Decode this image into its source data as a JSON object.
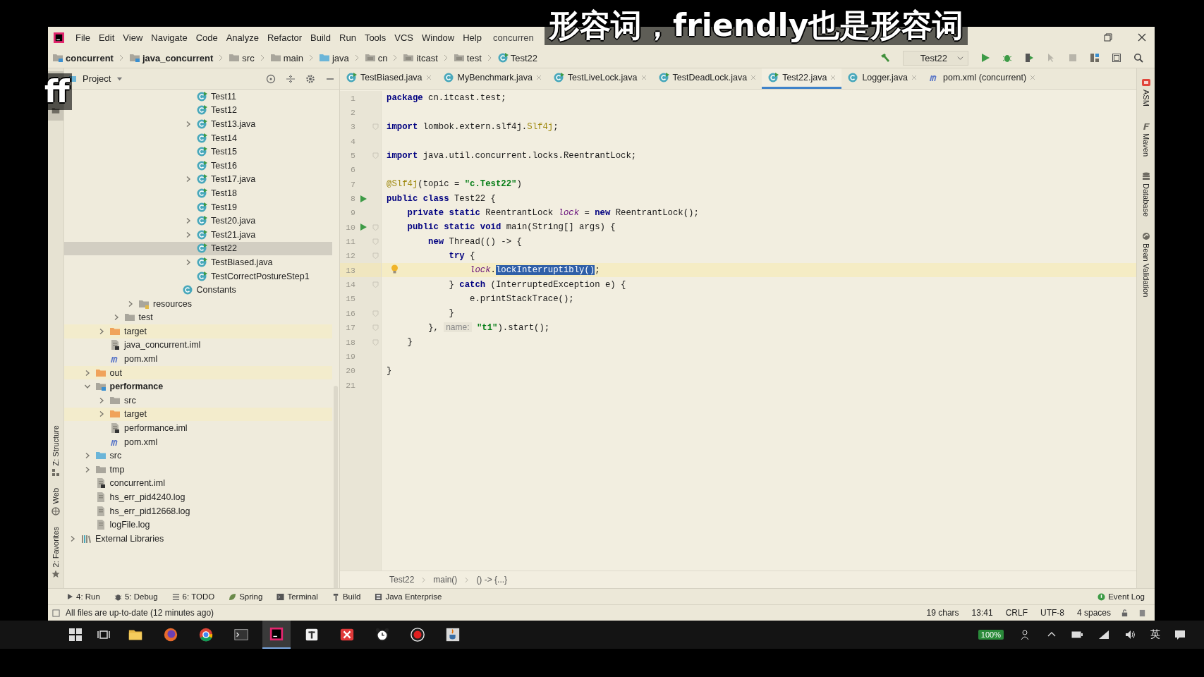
{
  "overlay": {
    "subtitle": "形容词，friendly也是形容词",
    "fragment": "ff"
  },
  "window": {
    "title": "concurren"
  },
  "menu": [
    "File",
    "Edit",
    "View",
    "Navigate",
    "Code",
    "Analyze",
    "Refactor",
    "Build",
    "Run",
    "Tools",
    "VCS",
    "Window",
    "Help"
  ],
  "navbar": {
    "crumbs": [
      {
        "label": "concurrent",
        "kind": "module"
      },
      {
        "label": "java_concurrent",
        "kind": "module"
      },
      {
        "label": "src",
        "kind": "folder"
      },
      {
        "label": "main",
        "kind": "folder"
      },
      {
        "label": "java",
        "kind": "source"
      },
      {
        "label": "cn",
        "kind": "package"
      },
      {
        "label": "itcast",
        "kind": "package"
      },
      {
        "label": "test",
        "kind": "package"
      },
      {
        "label": "Test22",
        "kind": "runnable"
      }
    ],
    "run_config": "Test22"
  },
  "project": {
    "title": "Project",
    "tree": [
      {
        "children": [
          {
            "children": [
              {
                "children": [
                  {
                    "children": [
                      {
                        "children": [
                          {
                            "children": [
                              {
                                "children": [
                                  {
                                    "children": [
                                      {
                                        "label": "Test11",
                                        "kind": "runnable",
                                        "selected": false,
                                        "excluded": false
                                      },
                                      {
                                        "label": "Test12",
                                        "kind": "runnable",
                                        "selected": false,
                                        "excluded": false
                                      },
                                      {
                                        "label": "Test13.java",
                                        "kind": "runnable",
                                        "expanded": false,
                                        "selected": false,
                                        "excluded": false
                                      },
                                      {
                                        "label": "Test14",
                                        "kind": "runnable",
                                        "selected": false,
                                        "excluded": false
                                      },
                                      {
                                        "label": "Test15",
                                        "kind": "runnable",
                                        "selected": false,
                                        "excluded": false
                                      },
                                      {
                                        "label": "Test16",
                                        "kind": "runnable",
                                        "selected": false,
                                        "excluded": false
                                      },
                                      {
                                        "label": "Test17.java",
                                        "kind": "runnable",
                                        "expanded": false,
                                        "selected": false,
                                        "excluded": false
                                      },
                                      {
                                        "label": "Test18",
                                        "kind": "runnable",
                                        "selected": false,
                                        "excluded": false
                                      },
                                      {
                                        "label": "Test19",
                                        "kind": "runnable",
                                        "selected": false,
                                        "excluded": false
                                      },
                                      {
                                        "label": "Test20.java",
                                        "kind": "runnable",
                                        "expanded": false,
                                        "selected": false,
                                        "excluded": false
                                      },
                                      {
                                        "label": "Test21.java",
                                        "kind": "runnable",
                                        "expanded": false,
                                        "selected": false,
                                        "excluded": false
                                      },
                                      {
                                        "label": "Test22",
                                        "kind": "runnable",
                                        "selected": true,
                                        "excluded": false
                                      },
                                      {
                                        "label": "TestBiased.java",
                                        "kind": "runnable",
                                        "expanded": false,
                                        "selected": false,
                                        "excluded": false
                                      },
                                      {
                                        "label": "TestCorrectPostureStep1",
                                        "kind": "runnable",
                                        "selected": false,
                                        "excluded": false
                                      }
                                    ]
                                  },
                                  {
                                    "label": "Constants",
                                    "kind": "class",
                                    "selected": false,
                                    "excluded": false
                                  }
                                ]
                              }
                            ]
                          }
                        ]
                      },
                      {
                        "label": "resources",
                        "kind": "resources",
                        "expanded": false,
                        "selected": false,
                        "excluded": false
                      }
                    ]
                  },
                  {
                    "label": "test",
                    "kind": "folder",
                    "expanded": false,
                    "selected": false,
                    "excluded": false
                  }
                ]
              },
              {
                "label": "target",
                "kind": "folder",
                "expanded": false,
                "selected": false,
                "excluded": true
              },
              {
                "label": "java_concurrent.iml",
                "kind": "iml",
                "selected": false,
                "excluded": false
              },
              {
                "label": "pom.xml",
                "kind": "maven",
                "selected": false,
                "excluded": false
              }
            ]
          },
          {
            "label": "out",
            "kind": "folder",
            "expanded": false,
            "selected": false,
            "excluded": true
          },
          {
            "label": "performance",
            "kind": "module",
            "expanded": true,
            "selected": false,
            "excluded": false,
            "children": [
              {
                "label": "src",
                "kind": "folder",
                "expanded": false,
                "selected": false,
                "excluded": false
              },
              {
                "label": "target",
                "kind": "folder",
                "expanded": false,
                "selected": false,
                "excluded": true
              },
              {
                "label": "performance.iml",
                "kind": "iml",
                "selected": false,
                "excluded": false
              },
              {
                "label": "pom.xml",
                "kind": "maven",
                "selected": false,
                "excluded": false
              }
            ]
          },
          {
            "label": "src",
            "kind": "source",
            "expanded": false,
            "selected": false,
            "excluded": false
          },
          {
            "label": "tmp",
            "kind": "folder",
            "expanded": false,
            "selected": false,
            "excluded": false
          },
          {
            "label": "concurrent.iml",
            "kind": "iml",
            "selected": false,
            "excluded": false
          },
          {
            "label": "hs_err_pid4240.log",
            "kind": "log",
            "selected": false,
            "excluded": false
          },
          {
            "label": "hs_err_pid12668.log",
            "kind": "log",
            "selected": false,
            "excluded": false
          },
          {
            "label": "logFile.log",
            "kind": "log",
            "selected": false,
            "excluded": false
          }
        ]
      },
      {
        "label": "External Libraries",
        "kind": "library",
        "expanded": false,
        "selected": false,
        "excluded": false
      }
    ]
  },
  "tabs": [
    {
      "label": "TestBiased.java",
      "kind": "runnable",
      "selected": false
    },
    {
      "label": "MyBenchmark.java",
      "kind": "class",
      "selected": false
    },
    {
      "label": "TestLiveLock.java",
      "kind": "runnable",
      "selected": false
    },
    {
      "label": "TestDeadLock.java",
      "kind": "runnable",
      "selected": false
    },
    {
      "label": "Test22.java",
      "kind": "runnable",
      "selected": true
    },
    {
      "label": "Logger.java",
      "kind": "class",
      "selected": false
    },
    {
      "label": "pom.xml (concurrent)",
      "kind": "maven",
      "selected": false
    }
  ],
  "editor": {
    "lines": [
      {
        "n": "1",
        "tokens": [
          {
            "text": "package",
            "kind": "keyword"
          },
          {
            "text": " cn.itcast.test;",
            "kind": "plain"
          }
        ]
      },
      {
        "n": "2"
      },
      {
        "n": "3",
        "fold": true,
        "tokens": [
          {
            "text": "import",
            "kind": "keyword"
          },
          {
            "text": " lombok.extern.slf4j.",
            "kind": "plain"
          },
          {
            "text": "Slf4j",
            "kind": "annotation"
          },
          {
            "text": ";",
            "kind": "plain"
          }
        ]
      },
      {
        "n": "4"
      },
      {
        "n": "5",
        "fold": true,
        "tokens": [
          {
            "text": "import",
            "kind": "keyword"
          },
          {
            "text": " java.util.concurrent.locks.ReentrantLock;",
            "kind": "plain"
          }
        ]
      },
      {
        "n": "6"
      },
      {
        "n": "7",
        "tokens": [
          {
            "text": "@Slf4j",
            "kind": "annotation"
          },
          {
            "text": "(topic = ",
            "kind": "plain"
          },
          {
            "text": "\"c.Test22\"",
            "kind": "string"
          },
          {
            "text": ")",
            "kind": "plain"
          }
        ]
      },
      {
        "n": "8",
        "run": true,
        "tokens": [
          {
            "text": "public class",
            "kind": "keyword"
          },
          {
            "text": " Test22 {",
            "kind": "plain"
          }
        ]
      },
      {
        "n": "9",
        "tokens": [
          {
            "text": "    private static",
            "kind": "keyword"
          },
          {
            "text": " ReentrantLock ",
            "kind": "plain"
          },
          {
            "text": "lock",
            "kind": "field"
          },
          {
            "text": " = ",
            "kind": "plain"
          },
          {
            "text": "new",
            "kind": "keyword"
          },
          {
            "text": " ReentrantLock();",
            "kind": "plain"
          }
        ]
      },
      {
        "n": "10",
        "run": true,
        "fold": true,
        "tokens": [
          {
            "text": "    public static void",
            "kind": "keyword"
          },
          {
            "text": " main(String[] args) {",
            "kind": "plain"
          }
        ]
      },
      {
        "n": "11",
        "fold": true,
        "tokens": [
          {
            "text": "        new",
            "kind": "keyword"
          },
          {
            "text": " Thread(() -> {",
            "kind": "plain"
          }
        ]
      },
      {
        "n": "12",
        "fold": true,
        "tokens": [
          {
            "text": "            try",
            "kind": "keyword"
          },
          {
            "text": " {",
            "kind": "plain"
          }
        ]
      },
      {
        "n": "13",
        "current": true,
        "bulb": true,
        "tokens": [
          {
            "text": "                lock",
            "kind": "field"
          },
          {
            "text": ".",
            "kind": "plain"
          },
          {
            "text": "lockInterruptibly()",
            "kind": "selected"
          },
          {
            "text": ";",
            "kind": "plain"
          }
        ]
      },
      {
        "n": "14",
        "fold": true,
        "tokens": [
          {
            "text": "            } ",
            "kind": "plain"
          },
          {
            "text": "catch",
            "kind": "keyword"
          },
          {
            "text": " (InterruptedException e) {",
            "kind": "plain"
          }
        ]
      },
      {
        "n": "15",
        "tokens": [
          {
            "text": "                e.printStackTrace();",
            "kind": "plain"
          }
        ]
      },
      {
        "n": "16",
        "fold": true,
        "tokens": [
          {
            "text": "            }",
            "kind": "plain"
          }
        ]
      },
      {
        "n": "17",
        "fold": true,
        "tokens": [
          {
            "text": "        }, ",
            "kind": "plain"
          },
          {
            "text": "name:",
            "kind": "hint"
          },
          {
            "text": " \"t1\"",
            "kind": "string"
          },
          {
            "text": ").start();",
            "kind": "plain"
          }
        ]
      },
      {
        "n": "18",
        "fold": true,
        "tokens": [
          {
            "text": "    }",
            "kind": "plain"
          }
        ]
      },
      {
        "n": "19"
      },
      {
        "n": "20",
        "tokens": [
          {
            "text": "}",
            "kind": "plain"
          }
        ]
      },
      {
        "n": "21"
      }
    ],
    "breadcrumb": [
      "Test22",
      "main()",
      "() -> {...}"
    ]
  },
  "left_strip": [
    {
      "label": "Z: Structure",
      "kind": "structure"
    },
    {
      "label": "Web",
      "kind": "web"
    },
    {
      "label": "2: Favorites",
      "kind": "star"
    }
  ],
  "right_strip": [
    {
      "label": "ASM",
      "kind": "asm"
    },
    {
      "label": "Maven",
      "kind": "maven"
    },
    {
      "label": "Database",
      "kind": "database"
    },
    {
      "label": "Bean Validation",
      "kind": "bean"
    }
  ],
  "tool_buttons": [
    {
      "label": "4: Run",
      "kind": "run"
    },
    {
      "label": "5: Debug",
      "kind": "debug"
    },
    {
      "label": "6: TODO",
      "kind": "list"
    },
    {
      "label": "Spring",
      "kind": "leaf"
    },
    {
      "label": "Terminal",
      "kind": "terminal"
    },
    {
      "label": "Build",
      "kind": "hammer"
    },
    {
      "label": "Java Enterprise",
      "kind": "enterprise"
    }
  ],
  "event_log": "Event Log",
  "status": {
    "message": "All files are up-to-date (12 minutes ago)",
    "items": [
      "19 chars",
      "13:41",
      "CRLF",
      "UTF-8",
      "4 spaces"
    ]
  },
  "taskbar": {
    "apps": [
      {
        "kind": "files",
        "selected": false
      },
      {
        "kind": "firefox",
        "selected": false
      },
      {
        "kind": "chrome",
        "selected": false
      },
      {
        "kind": "terminal",
        "selected": false
      },
      {
        "kind": "ide",
        "selected": true
      },
      {
        "kind": "notes",
        "selected": false
      },
      {
        "kind": "xmind",
        "selected": false
      },
      {
        "kind": "clock",
        "selected": false
      },
      {
        "kind": "record",
        "selected": false
      },
      {
        "kind": "java",
        "selected": false
      }
    ],
    "battery": "100%",
    "ime": "英"
  }
}
